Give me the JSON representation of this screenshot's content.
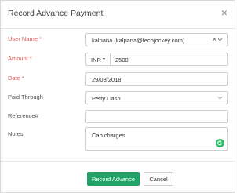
{
  "dialog": {
    "title": "Record Advance Payment",
    "close_symbol": "×"
  },
  "form": {
    "user_name": {
      "label": "User Name *",
      "value": "kalpana (kalpana@techjockey.com)",
      "clear_symbol": "×",
      "icon": "chevron-down-icon"
    },
    "amount": {
      "label": "Amount *",
      "currency": "INR",
      "currency_caret": "▾",
      "value": "2500"
    },
    "date": {
      "label": "Date *",
      "value": "29/08/2018"
    },
    "paid_through": {
      "label": "Paid Through",
      "value": "Petty Cash",
      "icon": "chevron-down-icon"
    },
    "reference": {
      "label": "Reference#",
      "value": ""
    },
    "notes": {
      "label": "Notes",
      "value": "Cab charges",
      "icon": "grammarly-icon"
    }
  },
  "footer": {
    "submit_label": "Record Advance",
    "cancel_label": "Cancel"
  },
  "colors": {
    "required_label": "#d9534f",
    "primary_button": "#21a366",
    "grammarly_badge": "#2ebd6b"
  }
}
